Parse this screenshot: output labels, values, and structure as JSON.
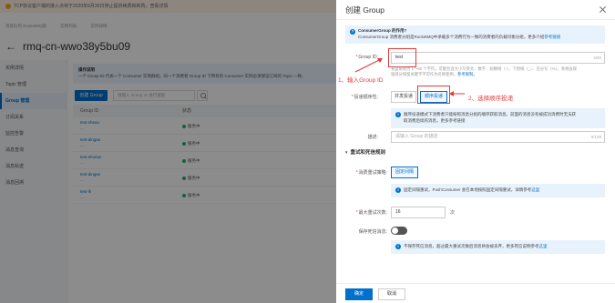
{
  "background": {
    "notice": "TCP协议客户端的接入点将于2020年6月30日停止提供续费和新购，查看详情",
    "notice_link": "查看详情",
    "breadcrumbs": [
      "消息队列 RocketMQ版",
      "实例列表",
      "实例详情"
    ],
    "instance_title": "rmq-cn-wwo38y5bu09",
    "sidebar": [
      "实例详情",
      "Topic 管理",
      "Group 管理",
      "订阅关系",
      "监控告警",
      "消息查询",
      "消息轨迹",
      "消息回溯"
    ],
    "sidebar_active_index": 2,
    "info_title": "操作说明",
    "info_text": "一个 Group ID 代表一个 Consumer 实例群组。同一个消费者 Group ID 下所有的 Consumer 实例必须保证订阅的 Topic 一致，",
    "create_button": "创建 Group",
    "search_placeholder": "请输入 Group ID 进行搜索",
    "table_headers": [
      "Group ID",
      "状态"
    ],
    "rows": [
      {
        "id": "test-sheau",
        "sub": "---",
        "status": "服务中"
      },
      {
        "id": "test-dingan",
        "sub": "---",
        "status": "服务中"
      },
      {
        "id": "test-shorius",
        "sub": "---",
        "status": "服务中"
      },
      {
        "id": "test-dingan",
        "sub": "---",
        "status": "服务中"
      },
      {
        "id": "test-lh",
        "sub": "---",
        "status": "服务中"
      }
    ]
  },
  "drawer": {
    "title": "创建 Group",
    "tip_title": "ConsumerGroup 的作用?",
    "tip_text": "ConsumerGroup 消费者分组是RocketMQ中承载多个消费行为一致的消费者的负载均衡分组，更多介绍",
    "tip_link": "参考链接",
    "group_id_label": "Group ID:",
    "group_id_value": "test",
    "group_id_count": "4/60",
    "group_id_help_1": "长度限制为 1～60 个字符，可能包含大小写英文、数字、短横线（-）、下划线（_）、百分号（%），系统会保",
    "group_id_help_2": "留部分保留关键字不可作为名称使用，",
    "group_id_help_link": "参考限制。",
    "annotation_1": "1、输入Group ID",
    "order_label": "投递顺序性:",
    "order_options": [
      "并发投递",
      "顺序投递"
    ],
    "order_selected_index": 1,
    "annotation_2": "2、选择顺序投递",
    "order_tip_1": "顺序投递模式下消费者只能按照消息分组的顺序获取消息。前面的消息没有被成功消费时无法获",
    "order_tip_2": "取消费后续的消息，更多参考链接",
    "order_tip_link": "参考链接",
    "desc_label": "描述:",
    "desc_placeholder": "请输入 Group 的描述",
    "desc_count": "0/128",
    "retry_section": "重试和死信规则",
    "retry_policy_label": "消费重试策略:",
    "retry_policy_value": "固定间隔",
    "retry_tip": "固定间隔重试，PushConsumer 会在本地按照固定间隔重试，详情参考",
    "retry_tip_link": "这里",
    "max_retry_label": "最大重试次数:",
    "max_retry_value": "16",
    "max_retry_unit": "次",
    "dead_letter_label": "保存死信消息:",
    "dead_letter_on": false,
    "dead_letter_tip": "不保存死信消息，超过最大重试次数后消息将会被丢弃，更多死信说明参考",
    "dead_letter_tip_link": "这里",
    "ok_button": "确定",
    "cancel_button": "取消"
  },
  "colors": {
    "accent": "#0070cc",
    "annotation": "#e4393c",
    "tip_bg": "#e8f2fc"
  }
}
